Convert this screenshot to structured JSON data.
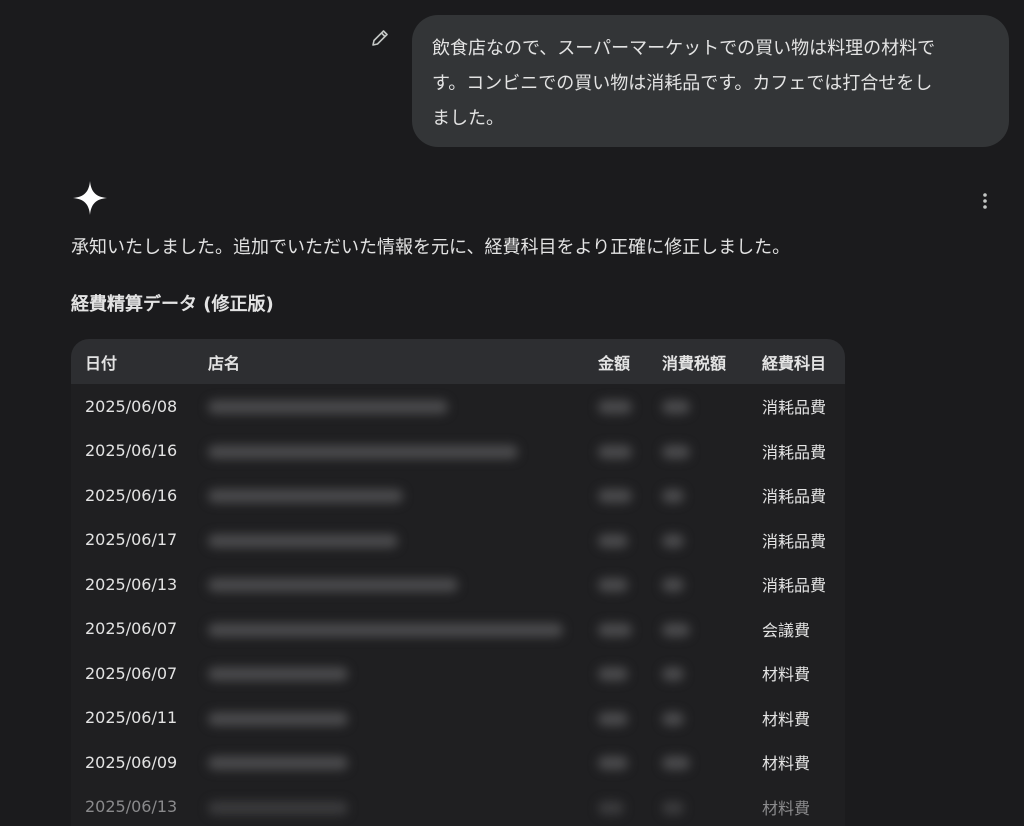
{
  "user_message": {
    "lines": [
      "飲食店なので、スーパーマーケットでの買い物は料理の材料で",
      "す。コンビニでの買い物は消耗品です。カフェでは打合せをし",
      "ました。"
    ]
  },
  "response": {
    "intro": "承知いたしました。追加でいただいた情報を元に、経費科目をより正確に修正しました。",
    "heading": "経費精算データ (修正版)"
  },
  "table": {
    "headers": [
      "日付",
      "店名",
      "金額",
      "消費税額",
      "経費科目"
    ],
    "rows": [
      {
        "date": "2025/06/08",
        "category": "消耗品費"
      },
      {
        "date": "2025/06/16",
        "category": "消耗品費"
      },
      {
        "date": "2025/06/16",
        "category": "消耗品費"
      },
      {
        "date": "2025/06/17",
        "category": "消耗品費"
      },
      {
        "date": "2025/06/13",
        "category": "消耗品費"
      },
      {
        "date": "2025/06/07",
        "category": "会議費"
      },
      {
        "date": "2025/06/07",
        "category": "材料費"
      },
      {
        "date": "2025/06/11",
        "category": "材料費"
      },
      {
        "date": "2025/06/09",
        "category": "材料費"
      },
      {
        "date": "2025/06/13",
        "category": "材料費"
      }
    ]
  },
  "icons": {
    "edit": "pencil-icon",
    "assistant": "sparkle-icon",
    "more": "more-vertical-icon"
  },
  "colors": {
    "background": "#1b1b1d",
    "bubble": "#333537",
    "table_header": "#2d2e31",
    "text": "#e3e3e3"
  }
}
